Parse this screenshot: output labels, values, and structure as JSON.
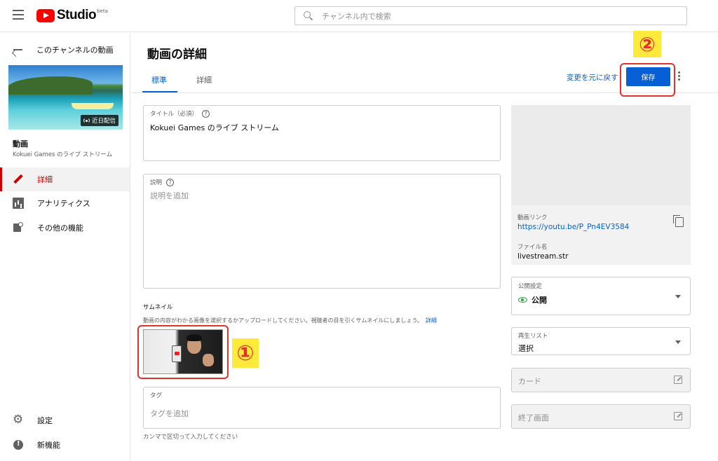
{
  "header": {
    "logo_text": "Studio",
    "logo_beta": "beta",
    "search_placeholder": "チャンネル内で検索"
  },
  "sidebar": {
    "back_label": "このチャンネルの動画",
    "video_badge": "近日配信",
    "video_section_label": "動画",
    "video_name": "Kokuei Games のライブ ストリーム",
    "nav": [
      {
        "label": "詳細",
        "icon": "pencil-icon",
        "active": true
      },
      {
        "label": "アナリティクス",
        "icon": "analytics-icon",
        "active": false
      },
      {
        "label": "その他の機能",
        "icon": "other-features-icon",
        "active": false
      }
    ],
    "bottom": [
      {
        "label": "設定",
        "icon": "gear-icon"
      },
      {
        "label": "新機能",
        "icon": "whats-new-icon"
      }
    ]
  },
  "main": {
    "title": "動画の詳細",
    "tabs": [
      {
        "label": "標準",
        "active": true
      },
      {
        "label": "詳細",
        "active": false
      }
    ],
    "undo_label": "変更を元に戻す",
    "save_label": "保存",
    "title_field": {
      "label": "タイトル（必須）",
      "value": "Kokuei Games のライブ ストリーム"
    },
    "description_field": {
      "label": "説明",
      "placeholder": "説明を追加"
    },
    "thumbnail": {
      "title": "サムネイル",
      "description": "動画の内容がわかる画像を選択するかアップロードしてください。視聴者の目を引くサムネイルにしましょう。",
      "link": "詳細"
    },
    "tags_field": {
      "label": "タグ",
      "placeholder": "タグを追加"
    },
    "tags_hint": "カンマで区切って入力してください"
  },
  "right": {
    "video_link_label": "動画リンク",
    "video_link": "https://youtu.be/P_Pn4EV3584",
    "file_name_label": "ファイル名",
    "file_name": "livestream.str",
    "visibility": {
      "label": "公開設定",
      "value": "公開"
    },
    "playlist": {
      "label": "再生リスト",
      "value": "選択"
    },
    "cards_label": "カード",
    "end_screen_label": "終了画面"
  },
  "annotations": {
    "marker_1": "①",
    "marker_2": "②",
    "color": "#e0322c",
    "marker_bg": "#ffe93b"
  },
  "colors": {
    "accent": "#065fd4",
    "active_nav": "#cc0000",
    "public_green": "#2ba640"
  }
}
